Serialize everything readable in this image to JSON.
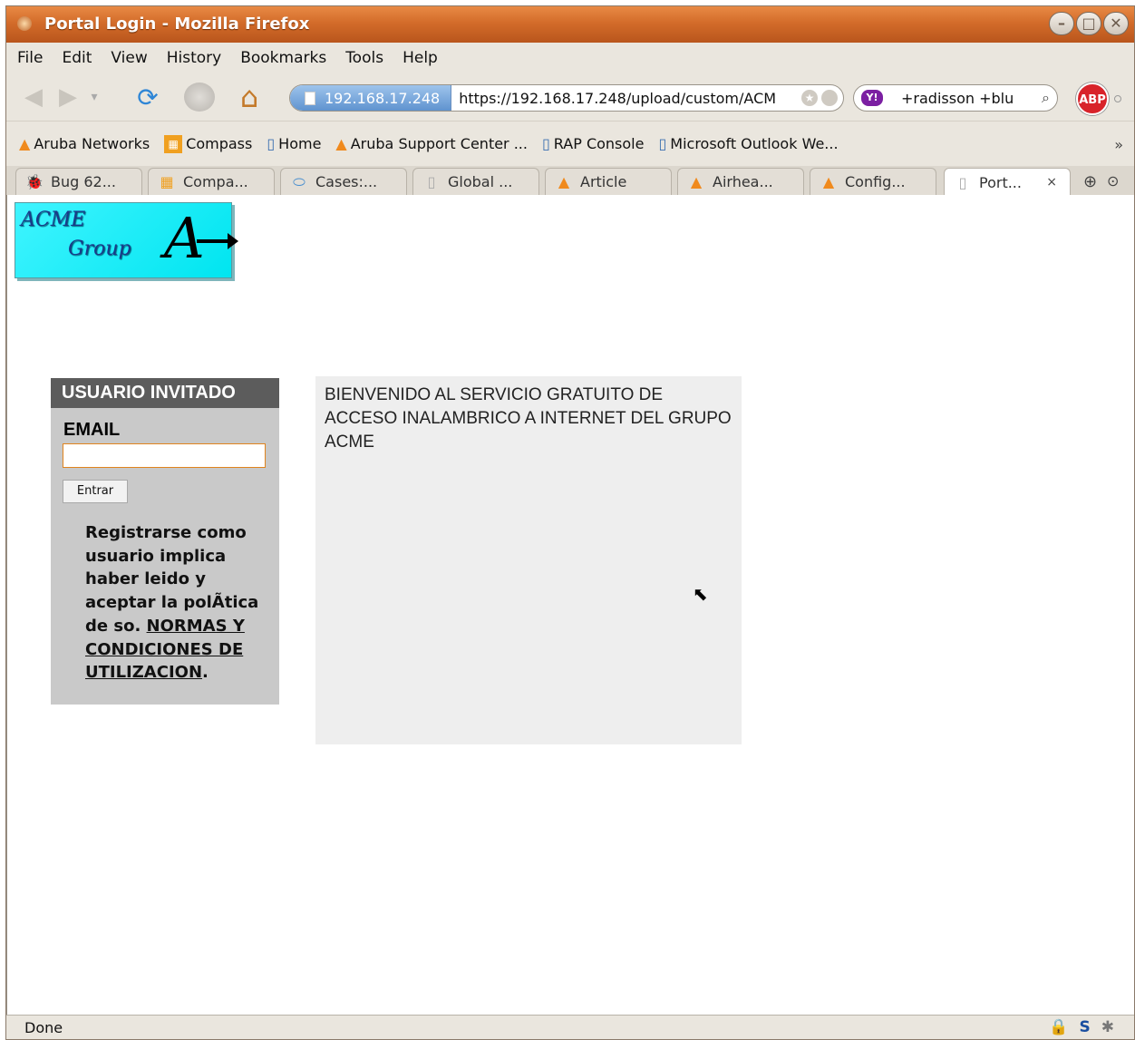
{
  "window": {
    "title": "Portal Login - Mozilla Firefox"
  },
  "menu": {
    "items": [
      "File",
      "Edit",
      "View",
      "History",
      "Bookmarks",
      "Tools",
      "Help"
    ]
  },
  "navigation": {
    "site_label": "192.168.17.248",
    "url": "https://192.168.17.248/upload/custom/ACM",
    "search_text": "+radisson +blu",
    "search_engine_icon": "yahoo-icon",
    "adblock_label": "ABP"
  },
  "bookmarks": [
    {
      "label": "Aruba Networks",
      "icon": "aruba-icon"
    },
    {
      "label": "Compass",
      "icon": "compass-icon"
    },
    {
      "label": "Home",
      "icon": "bookmark-icon"
    },
    {
      "label": "Aruba Support Center ...",
      "icon": "aruba-icon"
    },
    {
      "label": "RAP Console",
      "icon": "bookmark-icon"
    },
    {
      "label": "Microsoft Outlook We...",
      "icon": "bookmark-icon"
    }
  ],
  "bookmarks_more": "»",
  "tabs": [
    {
      "label": "Bug 62...",
      "icon": "bug-icon"
    },
    {
      "label": "Compa...",
      "icon": "compass-icon"
    },
    {
      "label": "Cases:...",
      "icon": "cases-icon"
    },
    {
      "label": "Global ...",
      "icon": "page-icon"
    },
    {
      "label": "Article",
      "icon": "aruba-icon"
    },
    {
      "label": "Airhea...",
      "icon": "aruba-icon"
    },
    {
      "label": "Config...",
      "icon": "aruba-icon"
    },
    {
      "label": "Port...",
      "icon": "page-icon",
      "active": true
    }
  ],
  "tab_close": "×",
  "page": {
    "logo_line1": "ACME",
    "logo_line2": "Group",
    "logo_mark": "A",
    "guest_header": "USUARIO INVITADO",
    "email_label": "EMAIL",
    "email_value": "",
    "submit_label": "Entrar",
    "terms_text": "Registrarse como usuario implica haber leido y aceptar la polÃtica de so. ",
    "terms_link": "NORMAS Y CONDICIONES DE UTILIZACION",
    "terms_end": ".",
    "welcome_text": "BIENVENIDO AL SERVICIO GRATUITO DE ACCESO INALAMBRICO A INTERNET DEL GRUPO ACME"
  },
  "status": {
    "text": "Done"
  },
  "colors": {
    "titlebar": "#d36c2a",
    "logo_bg": "#00e5f0",
    "guest_header_bg": "#5c5c5c",
    "panel_bg": "#c9c9c9",
    "input_border": "#e0841e"
  }
}
